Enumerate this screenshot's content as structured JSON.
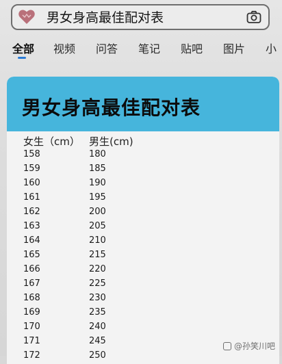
{
  "search": {
    "query": "男女身高最佳配对表",
    "heart_icon": "heart-icon",
    "camera_icon": "camera-icon"
  },
  "tabs": [
    {
      "label": "全部",
      "active": true
    },
    {
      "label": "视频",
      "active": false
    },
    {
      "label": "问答",
      "active": false
    },
    {
      "label": "笔记",
      "active": false
    },
    {
      "label": "贴吧",
      "active": false
    },
    {
      "label": "图片",
      "active": false
    },
    {
      "label": "小",
      "active": false
    }
  ],
  "card": {
    "title": "男女身高最佳配对表",
    "col_female": "女生（cm）",
    "col_male": "男生(cm)",
    "rows": [
      {
        "female": "158",
        "male": "180"
      },
      {
        "female": "159",
        "male": "185"
      },
      {
        "female": "160",
        "male": "190"
      },
      {
        "female": "161",
        "male": "195"
      },
      {
        "female": "162",
        "male": "200"
      },
      {
        "female": "163",
        "male": "205"
      },
      {
        "female": "164",
        "male": "210"
      },
      {
        "female": "165",
        "male": "215"
      },
      {
        "female": "166",
        "male": "220"
      },
      {
        "female": "167",
        "male": "225"
      },
      {
        "female": "168",
        "male": "230"
      },
      {
        "female": "169",
        "male": "235"
      },
      {
        "female": "170",
        "male": "240"
      },
      {
        "female": "171",
        "male": "245"
      },
      {
        "female": "172",
        "male": "250"
      }
    ]
  },
  "watermark": {
    "text": "@孙笑川吧"
  },
  "colors": {
    "banner": "#46b5dc",
    "accent": "#2a7bd6"
  }
}
